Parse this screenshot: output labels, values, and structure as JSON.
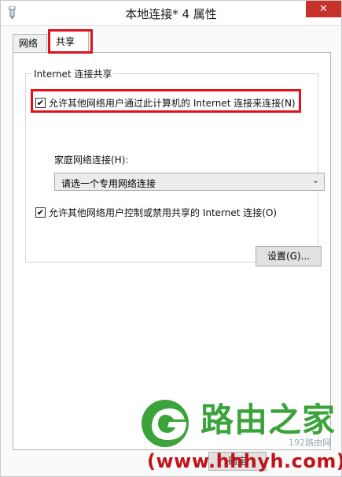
{
  "window": {
    "title": "本地连接* 4 属性",
    "close_glyph": "✕"
  },
  "tabs": [
    {
      "label": "网络",
      "selected": false
    },
    {
      "label": "共享",
      "selected": true
    }
  ],
  "sharing": {
    "group_title": "Internet 连接共享",
    "allow_share": {
      "label": "允许其他网络用户通过此计算机的 Internet 连接来连接(N)",
      "checked": true
    },
    "home_network_label": "家庭网络连接(H):",
    "home_network_select": {
      "value": "请选一个专用网络连接"
    },
    "allow_control": {
      "label": "允许其他网络用户控制或禁用共享的 Internet 连接(O)",
      "checked": true
    },
    "settings_button": "设置(G)..."
  },
  "footer": {
    "partial_button": "确定"
  },
  "watermark": {
    "brand": "路由之家",
    "url": "(www.hhhyh.com)",
    "small": "192路由网"
  },
  "colors": {
    "highlight_red": "#e0111a",
    "close_red": "#c7312b",
    "watermark_green": "#3aa33a",
    "watermark_red": "#c0141a"
  }
}
